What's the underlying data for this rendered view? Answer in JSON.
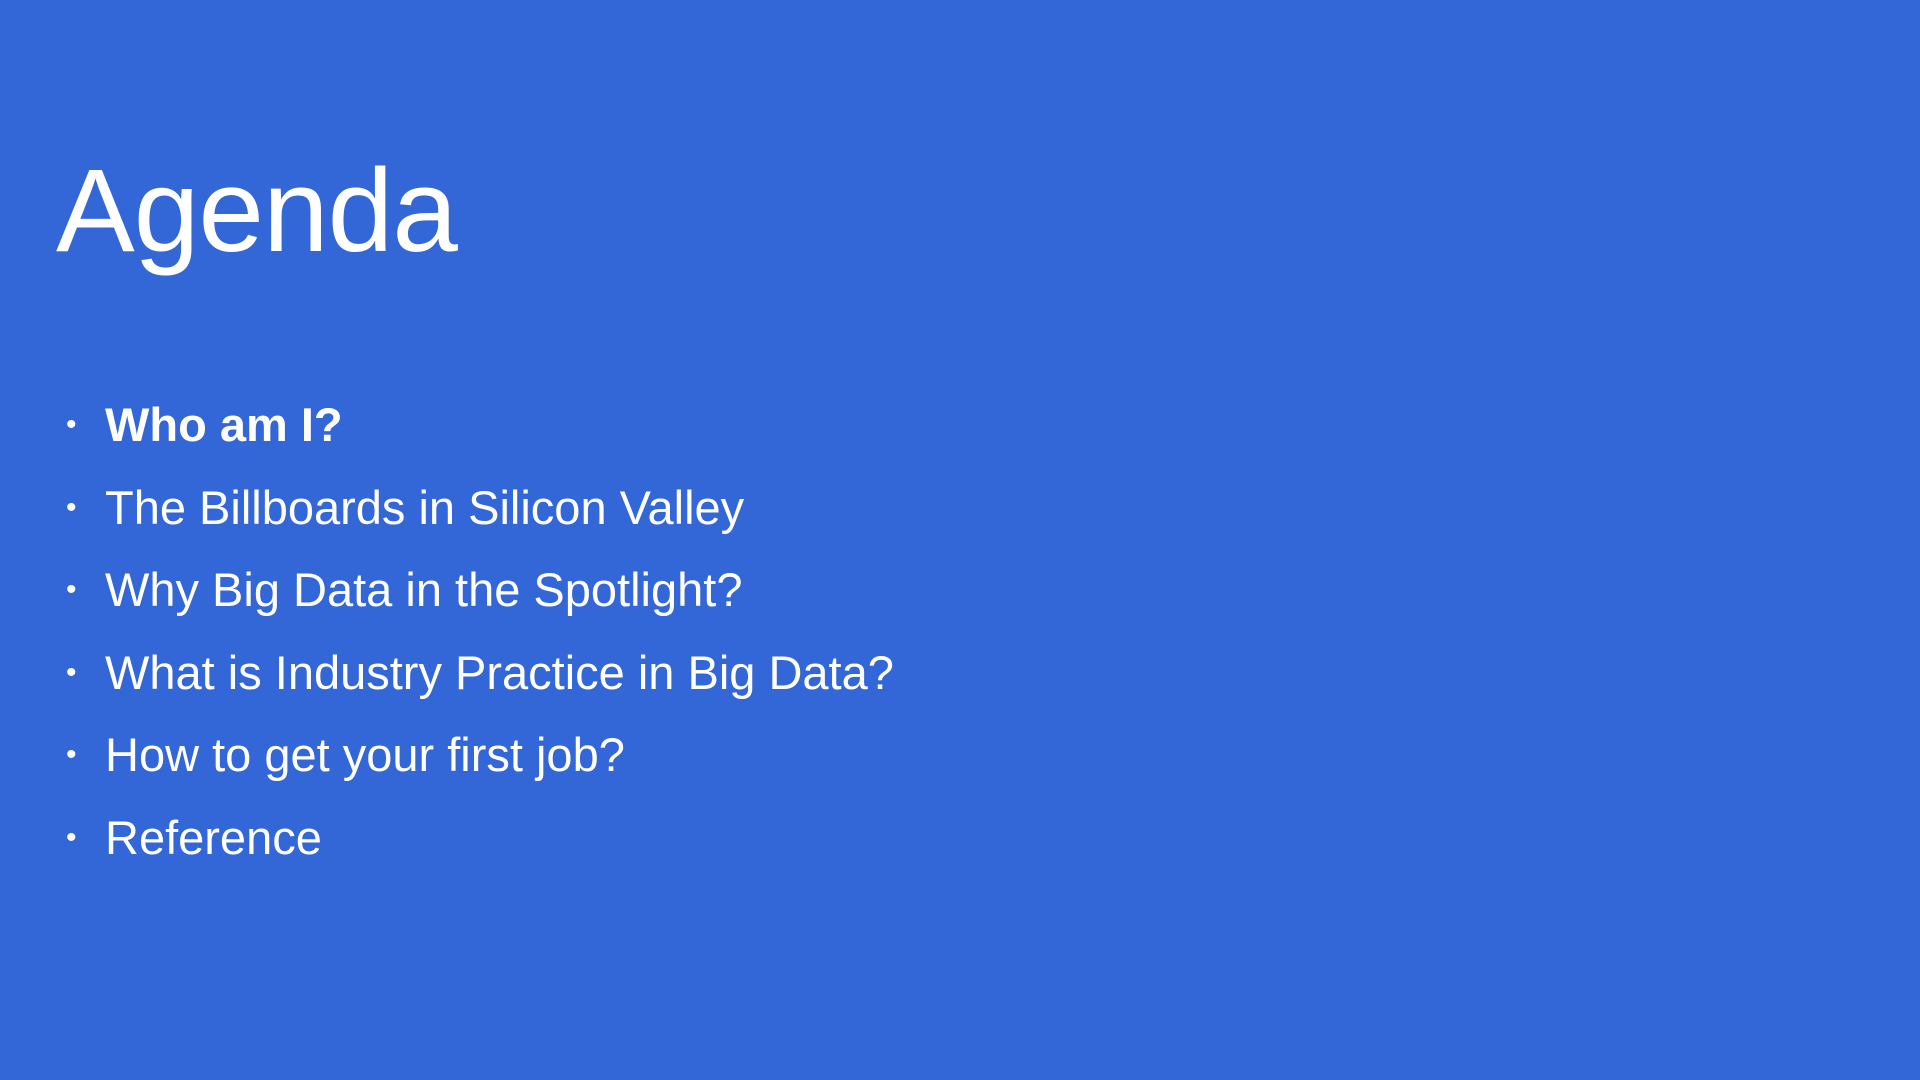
{
  "slide": {
    "title": "Agenda",
    "background_color": "#3366d6",
    "text_color": "#ffffff",
    "bullet_glyph": "•",
    "items": [
      {
        "label": "Who am I?",
        "bold": true
      },
      {
        "label": "The Billboards in Silicon Valley",
        "bold": false
      },
      {
        "label": "Why Big Data in the Spotlight?",
        "bold": false
      },
      {
        "label": "What is Industry Practice in Big Data?",
        "bold": false
      },
      {
        "label": "How to get your first job?",
        "bold": false
      },
      {
        "label": "Reference",
        "bold": false
      }
    ]
  }
}
